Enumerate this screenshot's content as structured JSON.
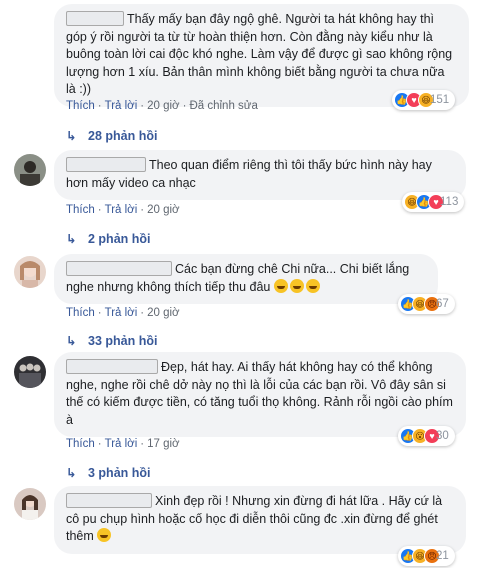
{
  "comments": [
    {
      "text": "Thấy mấy bạn đây ngộ ghê. Người ta hát không hay thì góp ý rồi người ta từ từ hoàn thiện hơn. Còn đằng này kiểu như là buông toàn lời cai độc khó nghe. Làm vậy để được gì sao không rộng lượng hơn 1 xíu. Bản thân mình không biết bằng người ta chưa nữa là :))",
      "like": "Thích",
      "reply": "Trả lời",
      "time": "20 giờ",
      "edited": "Đã chỉnh sửa",
      "reaction_count": "151",
      "reactions": [
        "like",
        "love",
        "haha"
      ],
      "replies_label": "28 phản hồi"
    },
    {
      "text": "Theo quan điểm riêng thì tôi thấy bức hình này hay hơn mấy video ca nhạc",
      "like": "Thích",
      "reply": "Trả lời",
      "time": "20 giờ",
      "reaction_count": "113",
      "reactions": [
        "haha",
        "like",
        "love"
      ],
      "replies_label": "2 phản hồi"
    },
    {
      "text": "Các bạn đừng chê Chi nữa... Chi biết lắng nghe nhưng không thích tiếp thu đâu",
      "like": "Thích",
      "reply": "Trả lời",
      "time": "20 giờ",
      "reaction_count": "67",
      "reactions": [
        "like",
        "haha",
        "angry"
      ],
      "replies_label": "33 phản hồi"
    },
    {
      "text": "Đẹp, hát hay. Ai thấy hát không hay có thể không nghe, nghe rồi chê dở này nọ thì là lỗi của các bạn rồi. Vô đây sân si thế có kiếm được tiền, có tăng tuổi thọ không. Rảnh rỗi ngồi cào phím à",
      "like": "Thích",
      "reply": "Trả lời",
      "time": "17 giờ",
      "reaction_count": "30",
      "reactions": [
        "like",
        "wow",
        "love"
      ],
      "replies_label": "3 phản hồi"
    },
    {
      "text": "Xinh đẹp rồi ! Nhưng xin đừng đi hát lữa . Hãy cứ là cô pu chụp hình hoặc cố học đi diễn thôi cũng đc .xin đừng để ghét thêm",
      "like": "Thích",
      "reply": "Trả lời",
      "time": "20 giờ",
      "reaction_count": "21",
      "reactions": [
        "like",
        "haha",
        "angry"
      ]
    }
  ]
}
